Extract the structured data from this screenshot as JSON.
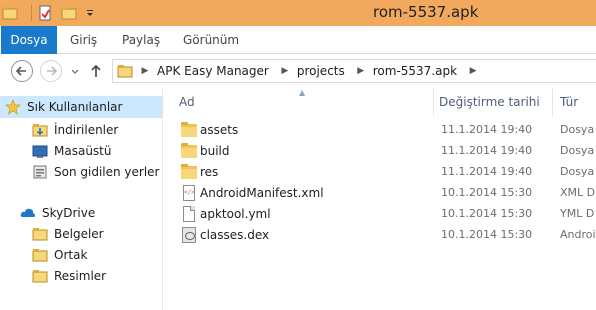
{
  "window": {
    "title": "rom-5537.apk"
  },
  "ribbon": {
    "tabs": [
      {
        "label": "Dosya",
        "active": true
      },
      {
        "label": "Giriş"
      },
      {
        "label": "Paylaş"
      },
      {
        "label": "Görünüm"
      }
    ]
  },
  "address": {
    "crumbs": [
      "APK Easy Manager",
      "projects",
      "rom-5537.apk"
    ]
  },
  "navpane": {
    "favorites_label": "Sık Kullanılanlar",
    "favorites": [
      "İndirilenler",
      "Masaüstü",
      "Son gidilen yerler"
    ],
    "skydrive_label": "SkyDrive",
    "skydrive": [
      "Belgeler",
      "Ortak",
      "Resimler"
    ]
  },
  "columns": {
    "name": "Ad",
    "date": "Değiştirme tarihi",
    "type": "Tür"
  },
  "files": [
    {
      "name": "assets",
      "date": "11.1.2014 19:40",
      "type": "Dosya",
      "icon": "folder-icon"
    },
    {
      "name": "build",
      "date": "11.1.2014 19:40",
      "type": "Dosya",
      "icon": "folder-icon"
    },
    {
      "name": "res",
      "date": "11.1.2014 19:40",
      "type": "Dosya",
      "icon": "folder-icon"
    },
    {
      "name": "AndroidManifest.xml",
      "date": "10.1.2014 15:30",
      "type": "XML D",
      "icon": "xml-file-icon"
    },
    {
      "name": "apktool.yml",
      "date": "10.1.2014 15:30",
      "type": "YML D",
      "icon": "file-icon"
    },
    {
      "name": "classes.dex",
      "date": "10.1.2014 15:30",
      "type": "Androi",
      "icon": "dex-file-icon"
    }
  ],
  "colors": {
    "titlebar": "#f0a95d",
    "file_tab": "#1979ca",
    "selected": "#cce8ff",
    "folder": "#f0c353"
  }
}
